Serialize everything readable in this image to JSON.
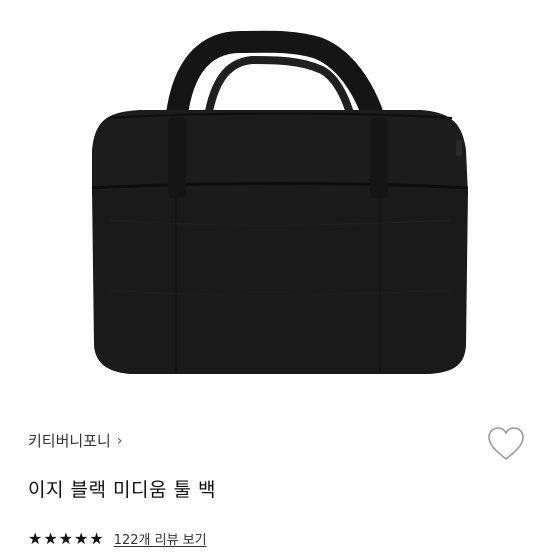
{
  "product": {
    "brand": "키티버니포니",
    "brand_chevron": "›",
    "title": "이지 블랙 미디움 툴 백",
    "rating_stars": 5,
    "review_link": "122개 리뷰 보기",
    "image_subject": "black canvas tool bag",
    "bag_color": "#1b1b1b",
    "like_icon": "heart-outline-icon"
  },
  "colors": {
    "image_background": "#ffffff",
    "info_background": "#ffffff",
    "text_primary": "#111111",
    "text_secondary": "#333333",
    "heart_stroke": "#999999"
  }
}
